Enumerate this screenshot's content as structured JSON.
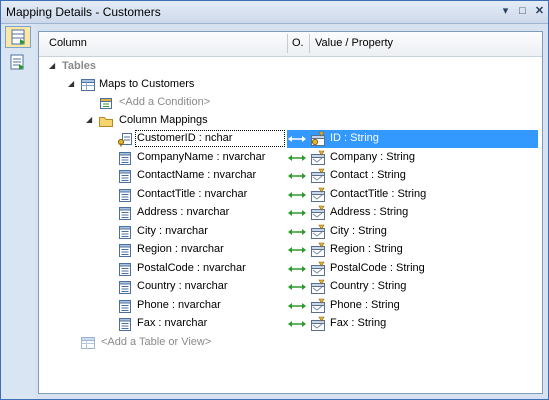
{
  "window": {
    "title": "Mapping Details - Customers"
  },
  "title_buttons": {
    "menu": "▾",
    "maximize": "□",
    "close": "✕"
  },
  "header": {
    "column": "Column",
    "operator": "O.",
    "value_property": "Value / Property"
  },
  "tree": {
    "tables_label": "Tables",
    "maps_to_label": "Maps to Customers",
    "add_condition": "<Add a Condition>",
    "column_mappings_label": "Column Mappings",
    "add_table": "<Add a Table or View>",
    "mappings": [
      {
        "column": "CustomerID : nchar",
        "property": "ID : String",
        "key": true,
        "selected": true
      },
      {
        "column": "CompanyName : nvarchar",
        "property": "Company : String",
        "key": false,
        "selected": false
      },
      {
        "column": "ContactName : nvarchar",
        "property": "Contact : String",
        "key": false,
        "selected": false
      },
      {
        "column": "ContactTitle : nvarchar",
        "property": "ContactTitle : String",
        "key": false,
        "selected": false
      },
      {
        "column": "Address : nvarchar",
        "property": "Address : String",
        "key": false,
        "selected": false
      },
      {
        "column": "City : nvarchar",
        "property": "City : String",
        "key": false,
        "selected": false
      },
      {
        "column": "Region : nvarchar",
        "property": "Region : String",
        "key": false,
        "selected": false
      },
      {
        "column": "PostalCode : nvarchar",
        "property": "PostalCode : String",
        "key": false,
        "selected": false
      },
      {
        "column": "Country : nvarchar",
        "property": "Country : String",
        "key": false,
        "selected": false
      },
      {
        "column": "Phone : nvarchar",
        "property": "Phone : String",
        "key": false,
        "selected": false
      },
      {
        "column": "Fax : nvarchar",
        "property": "Fax : String",
        "key": false,
        "selected": false
      }
    ]
  },
  "colors": {
    "selection": "#3399ff",
    "arrow": "#2e9a2e",
    "window_border": "#3c6fb5"
  }
}
